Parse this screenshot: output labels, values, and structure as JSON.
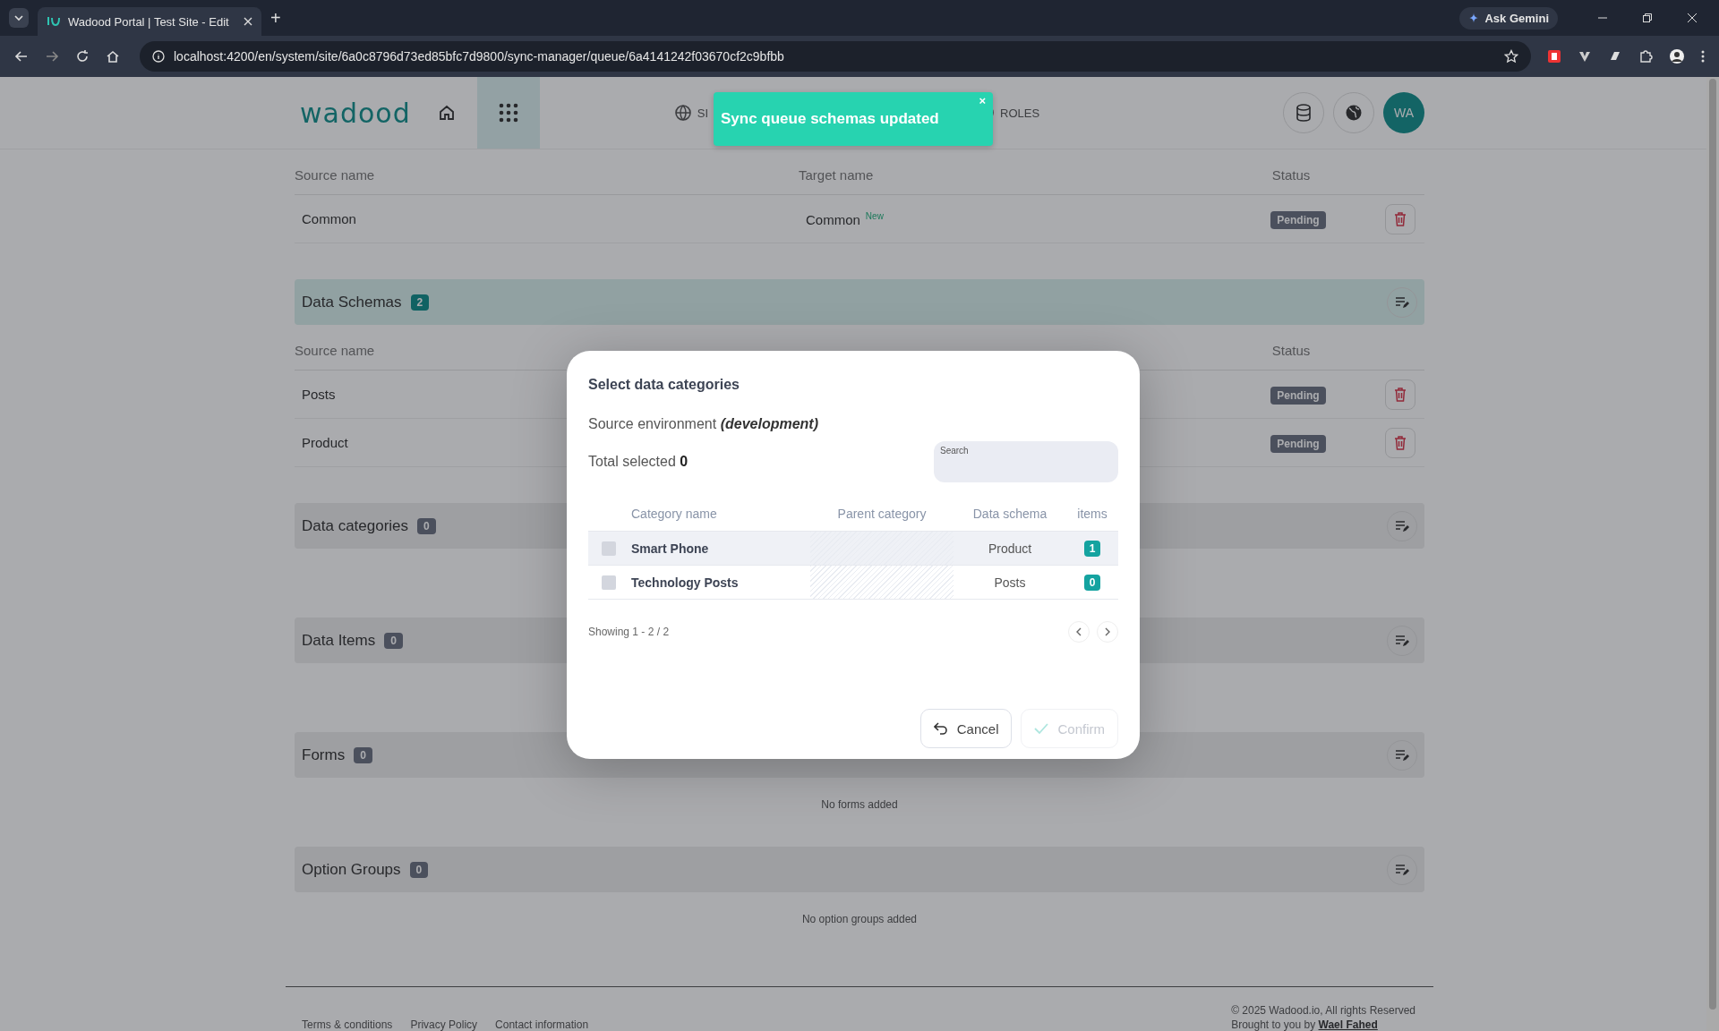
{
  "browser": {
    "tab_title": "Wadood Portal | Test Site - Edit",
    "new_tab": "+",
    "url": "localhost:4200/en/system/site/6a0c8796d73ed85bfc7d9800/sync-manager/queue/6a4141242f03670cf2c9bfbb",
    "assistant": "Ask Gemini"
  },
  "header": {
    "logo": "wadood",
    "nav": [
      {
        "label": "SI"
      },
      {
        "label": "ROLES"
      }
    ],
    "avatar": "WA"
  },
  "toast": {
    "message": "Sync queue schemas updated",
    "close": "×"
  },
  "top_table": {
    "columns": [
      "Source name",
      "Target name",
      "Status"
    ],
    "rows": [
      {
        "source": "Common",
        "target": "Common",
        "tag": "New",
        "status": "Pending"
      }
    ]
  },
  "sections": [
    {
      "title": "Data Schemas",
      "count": "2",
      "highlighted": true,
      "columns": [
        "Source name",
        "Status"
      ],
      "rows": [
        {
          "source": "Posts",
          "status": "Pending"
        },
        {
          "source": "Product",
          "status": "Pending"
        }
      ]
    },
    {
      "title": "Data categories",
      "count": "0",
      "highlighted": false
    },
    {
      "title": "Data Items",
      "count": "0",
      "highlighted": false
    },
    {
      "title": "Forms",
      "count": "0",
      "highlighted": false,
      "empty_text": "No forms added"
    },
    {
      "title": "Option Groups",
      "count": "0",
      "highlighted": false,
      "empty_text": "No option groups added"
    }
  ],
  "modal": {
    "title": "Select data categories",
    "source_label": "Source environment",
    "source_env": "(development)",
    "total_label": "Total selected",
    "total_value": "0",
    "search": {
      "label": "Search"
    },
    "columns": [
      "Category name",
      "Parent category",
      "Data schema",
      "items"
    ],
    "rows": [
      {
        "name": "Smart Phone",
        "schema": "Product",
        "items": "1",
        "checked": false,
        "hovered": true
      },
      {
        "name": "Technology Posts",
        "schema": "Posts",
        "items": "0",
        "checked": false,
        "hovered": false
      }
    ],
    "showing": "Showing 1 - 2 / 2",
    "cancel": "Cancel",
    "confirm": {
      "label": "Confirm",
      "disabled": true
    }
  },
  "footer": {
    "links": [
      "Terms & conditions",
      "Privacy Policy",
      "Contact information"
    ],
    "copyright": "© 2025 Wadood.io, All rights Reserved",
    "credit": "Brought to you by",
    "author": "Wael Fahed"
  }
}
